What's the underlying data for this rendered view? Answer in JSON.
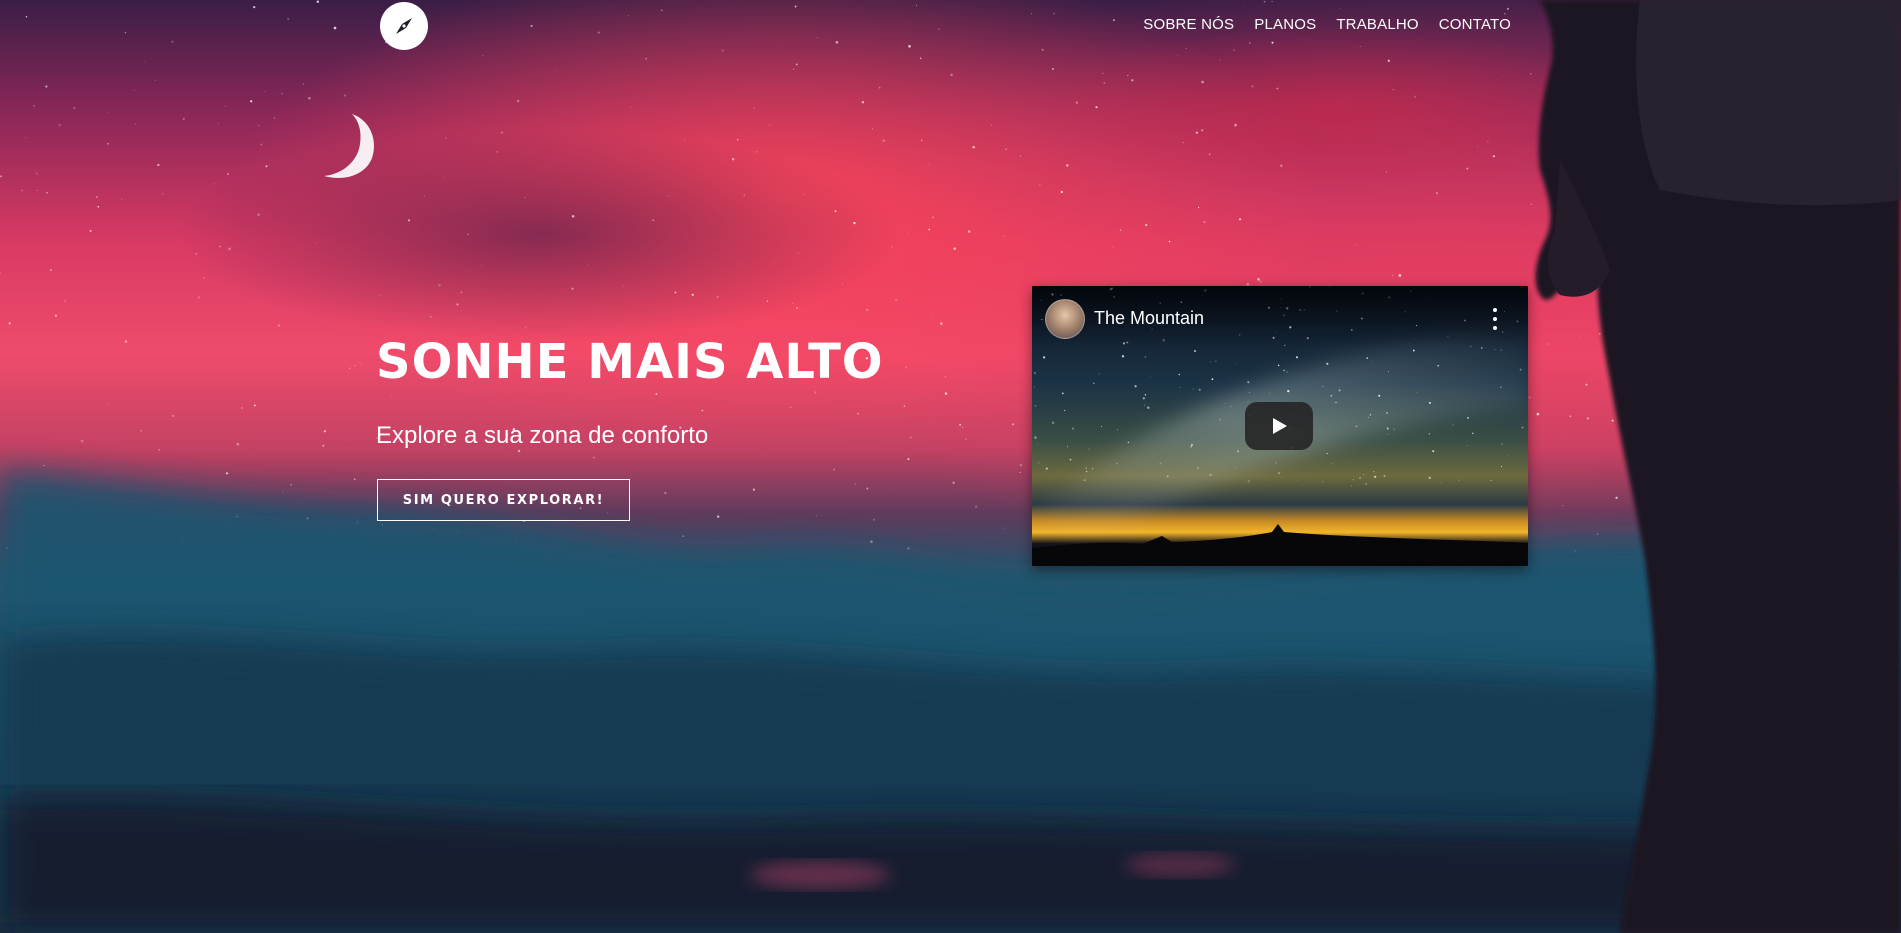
{
  "header": {
    "logo_icon": "compass-icon",
    "nav": [
      {
        "label": "SOBRE NÓS"
      },
      {
        "label": "PLANOS"
      },
      {
        "label": "TRABALHO"
      },
      {
        "label": "CONTATO"
      }
    ]
  },
  "hero": {
    "title": "SONHE MAIS ALTO",
    "subtitle": "Explore a sua zona de conforto",
    "cta_label": "SIM QUERO EXPLORAR!",
    "decor_icon": "crescent-moon-icon"
  },
  "video": {
    "title": "The Mountain",
    "play_icon": "play-icon",
    "menu_icon": "more-vertical-icon"
  },
  "colors": {
    "accent_pink": "#ef4b6c",
    "text": "#ffffff",
    "mountain_teal": "#1a4a62"
  }
}
